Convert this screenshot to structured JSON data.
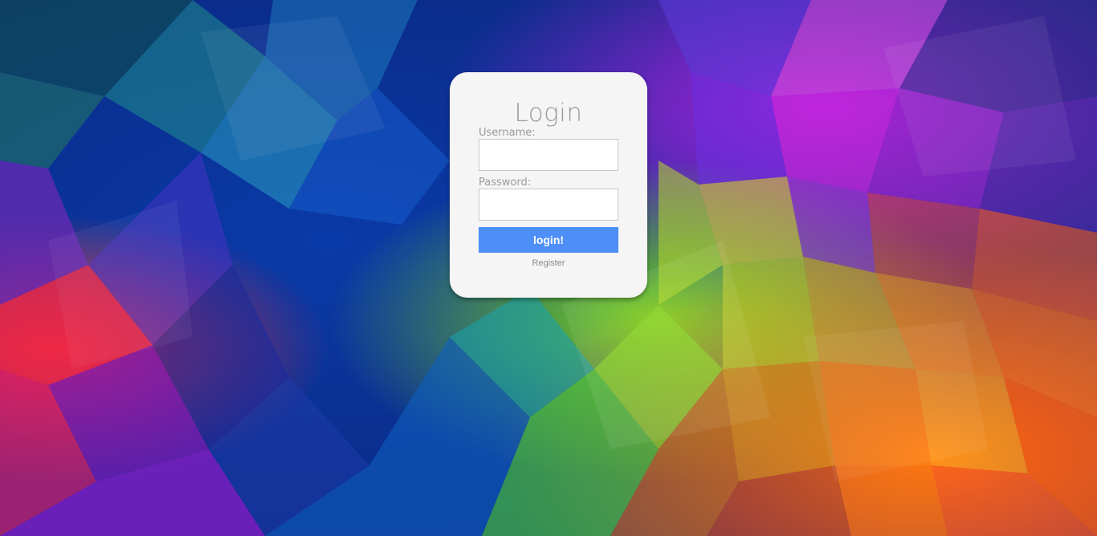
{
  "login": {
    "title": "Login",
    "username_label": "Username:",
    "username_value": "",
    "password_label": "Password:",
    "password_value": "",
    "submit_label": "login!",
    "register_label": "Register"
  },
  "colors": {
    "card_background": "#f5f5f5",
    "title_text": "#9a9a9a",
    "button_background": "#4d8ef7",
    "button_text": "#ffffff",
    "link_text": "#8a8a8a"
  },
  "background": {
    "style": "low-poly multicolor polygon art"
  }
}
